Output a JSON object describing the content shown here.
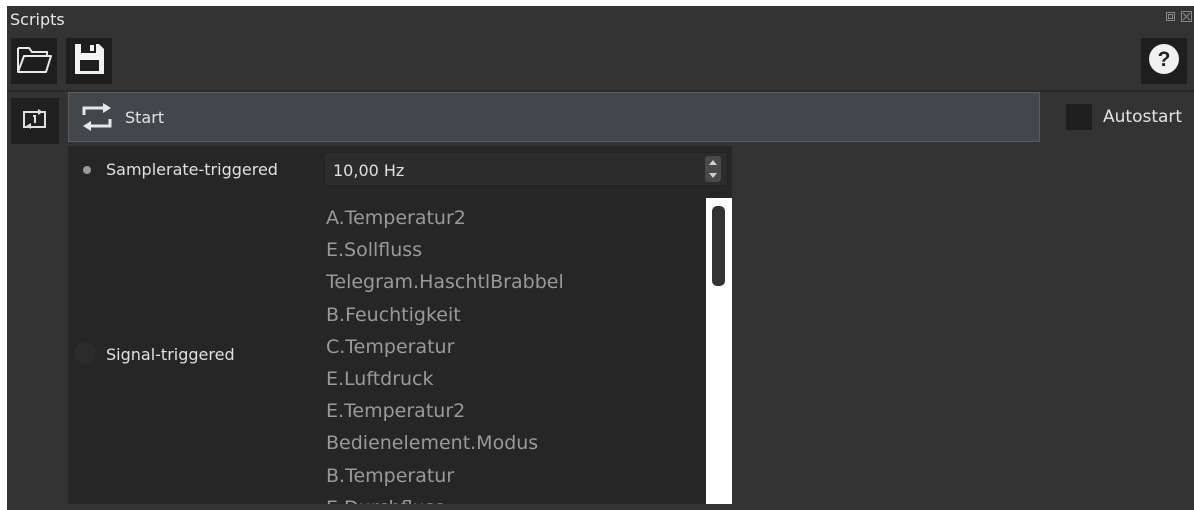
{
  "window": {
    "title": "Scripts",
    "float_icon": "float-icon",
    "close_icon": "close-icon"
  },
  "toolbar": {
    "open_icon": "folder-open-icon",
    "save_icon": "floppy-save-icon",
    "help_icon": "help-icon",
    "help_glyph": "?"
  },
  "controls": {
    "reload_icon": "reload-icon",
    "start_icon": "loop-icon",
    "start_label": "Start",
    "autostart_label": "Autostart",
    "autostart_checked": false
  },
  "trigger_popup": {
    "samplerate_option": {
      "label": "Samplerate-triggered",
      "selected": true,
      "value": "10,00 Hz"
    },
    "signal_option": {
      "label": "Signal-triggered",
      "selected": false
    },
    "signals": [
      "A.Temperatur2",
      "E.Sollfluss",
      "Telegram.HaschtlBrabbel",
      "B.Feuchtigkeit",
      "C.Temperatur",
      "E.Luftdruck",
      "E.Temperatur2",
      "Bedienelement.Modus",
      "B.Temperatur",
      "E.Durchfluss"
    ]
  },
  "colors": {
    "panel_bg": "#333333",
    "button_bg": "#1e1e1e",
    "start_bar_bg": "#42474c",
    "popup_bg": "#262626",
    "list_text": "#9a9a9a"
  }
}
